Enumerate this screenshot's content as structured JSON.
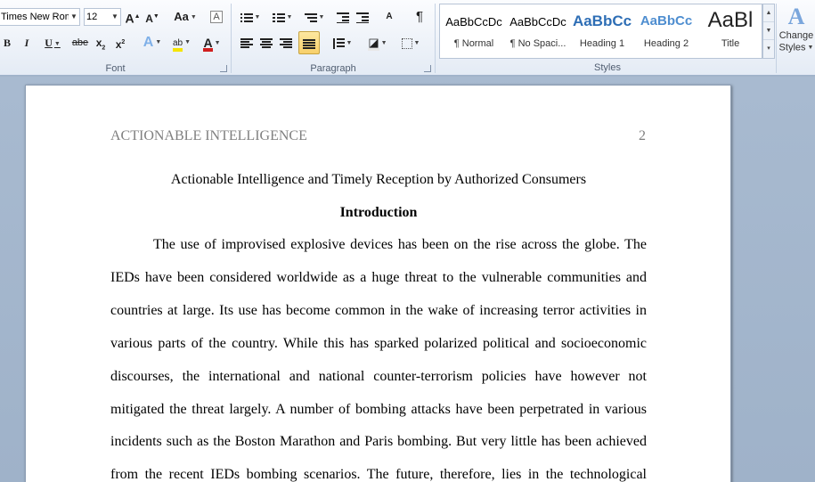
{
  "font_group": {
    "label": "Font",
    "font_name": "Times New Rom",
    "font_size": "12",
    "grow_font": "A",
    "shrink_font": "A",
    "change_case": "Aa",
    "clear_formatting": "A",
    "bold": "B",
    "italic": "I",
    "underline": "U",
    "strikethrough": "abe",
    "subscript": "x",
    "superscript": "x",
    "text_effects": "A",
    "highlight": "ab",
    "font_color": "A"
  },
  "paragraph_group": {
    "label": "Paragraph",
    "pilcrow": "¶"
  },
  "styles_group": {
    "label": "Styles",
    "items": [
      {
        "sample": "AaBbCcDc",
        "name": "¶ Normal"
      },
      {
        "sample": "AaBbCcDc",
        "name": "¶ No Spaci..."
      },
      {
        "sample": "AaBbCc",
        "name": "Heading 1"
      },
      {
        "sample": "AaBbCc",
        "name": "Heading 2"
      },
      {
        "sample": "AaBl",
        "name": "Title"
      }
    ],
    "change_styles": [
      "Change",
      "Styles"
    ]
  },
  "document": {
    "header": "ACTIONABLE INTELLIGENCE",
    "page_number": "2",
    "title": "Actionable Intelligence and Timely Reception by Authorized Consumers",
    "heading": "Introduction",
    "lines": [
      "The use of improvised explosive devices has been on the rise across the globe. The",
      "IEDs have been considered worldwide as a huge threat to the vulnerable communities and",
      "countries at large. Its use has become common in the wake of increasing terror activities in",
      "various parts of the country. While this has sparked polarized political and socioeconomic",
      "discourses, the international and national counter-terrorism policies have however not",
      "mitigated the threat largely. A number of bombing attacks have been perpetrated in various",
      "incidents such as the Boston Marathon and Paris bombing. But very little has been achieved",
      "from the recent IEDs bombing scenarios. The future, therefore, lies in the technological"
    ]
  },
  "colors": {
    "highlight": "#f5e400",
    "font_color": "#d01f1f",
    "heading_blue": "#3a78c0",
    "active_button": "#f8d66a"
  }
}
